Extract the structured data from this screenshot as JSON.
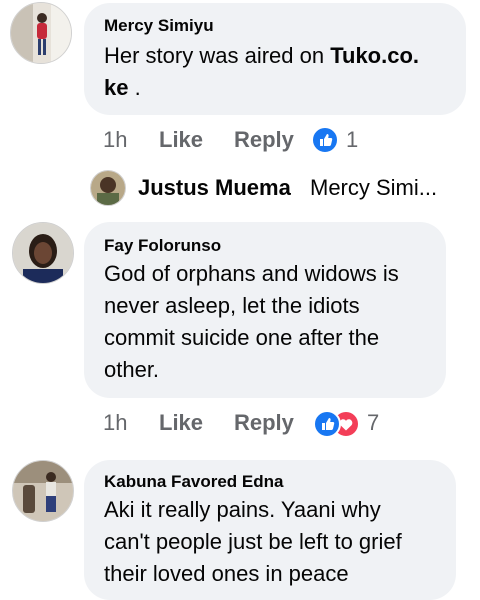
{
  "comments": [
    {
      "author": "Mercy Simiyu",
      "text_before": "Her story was aired on ",
      "text_bold": "Tuko.co.",
      "text_bold2": "ke",
      "text_after": " .",
      "time": "1h",
      "like_label": "Like",
      "reply_label": "Reply",
      "reaction_icons": [
        "like-icon"
      ],
      "reaction_count": "1"
    },
    {
      "author": "Fay Folorunso",
      "lines": [
        "God of orphans and widows is",
        "never asleep, let the idiots",
        "commit suicide one after the",
        "other."
      ],
      "time": "1h",
      "like_label": "Like",
      "reply_label": "Reply",
      "reaction_icons": [
        "like-icon",
        "love-icon"
      ],
      "reaction_count": "7"
    },
    {
      "author": "Kabuna Favored Edna",
      "lines": [
        "Aki it really pains. Yaani why",
        "can't people just be left to grief",
        "their loved ones in peace"
      ]
    }
  ],
  "reply_preview": {
    "author": "Justus Muema",
    "snippet": "Mercy Simi..."
  },
  "colors": {
    "like_blue": "#1877f2",
    "love_red": "#f33e58",
    "bubble_bg": "#f0f2f5",
    "meta_gray": "#65676b"
  }
}
